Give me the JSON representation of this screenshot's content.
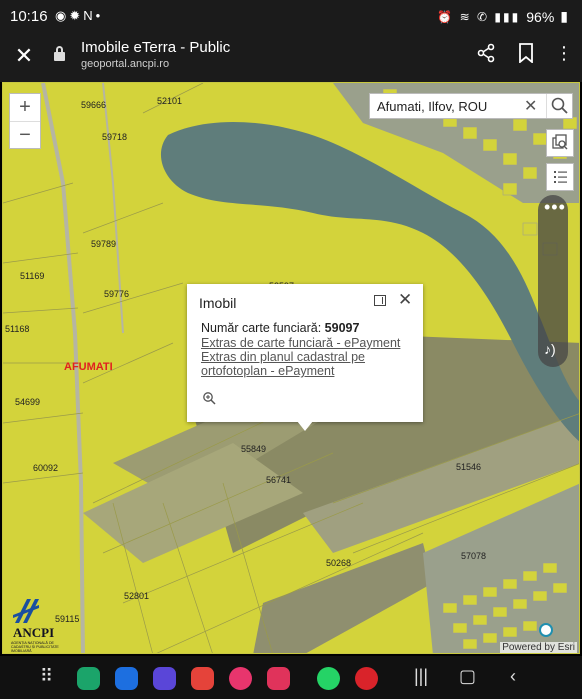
{
  "status_bar": {
    "time": "10:16",
    "left_icons": [
      "notification-icon",
      "gear-icon",
      "n-icon",
      "dot-icon"
    ],
    "battery": "96%",
    "right_icons": [
      "alarm-icon",
      "wifi-icon",
      "call-icon",
      "signal-icon",
      "battery-icon"
    ]
  },
  "browser": {
    "title": "Imobile eTerra - Public",
    "url": "geoportal.ancpi.ro",
    "close_icon": "close-icon",
    "share_icon": "share-icon",
    "bookmark_icon": "bookmark-icon",
    "menu_icon": "more-vert-icon"
  },
  "map": {
    "zoom_in": "+",
    "zoom_out": "−",
    "search": {
      "value": "Afumati, Ilfov, ROU"
    },
    "town": "AFUMATI",
    "parcels": [
      {
        "id": "p1",
        "label": "59666"
      },
      {
        "id": "p2",
        "label": "52101"
      },
      {
        "id": "p3",
        "label": "59718"
      },
      {
        "id": "p4",
        "label": "59789"
      },
      {
        "id": "p5",
        "label": "51169"
      },
      {
        "id": "p6",
        "label": "59776"
      },
      {
        "id": "p7",
        "label": "51168"
      },
      {
        "id": "p8",
        "label": "54699"
      },
      {
        "id": "p9",
        "label": "60092"
      },
      {
        "id": "p10",
        "label": "55849"
      },
      {
        "id": "p11",
        "label": "56741"
      },
      {
        "id": "p12",
        "label": "51546"
      },
      {
        "id": "p13",
        "label": "57078"
      },
      {
        "id": "p14",
        "label": "50268"
      },
      {
        "id": "p15",
        "label": "52801"
      },
      {
        "id": "p16",
        "label": "59115"
      },
      {
        "id": "p17",
        "label": "52597"
      }
    ],
    "attribution": "Powered by Esri",
    "logo_text": "ANCPI",
    "logo_subtext": "AGENȚIA NAȚIONALĂ DE CADASTRU ȘI PUBLICITATE IMOBILIARĂ",
    "colors": {
      "parcel_fill": "#d6d63a",
      "lake": "#5f7d7b",
      "road": "#b5b5a3",
      "town_label": "#e02020"
    }
  },
  "popup": {
    "title": "Imobil",
    "cf_label": "Număr carte funciară:",
    "cf_value": "59097",
    "link1": "Extras de carte funciară - ePayment",
    "link2_line1": "Extras din planul cadastral pe",
    "link2_line2": "ortofotoplan - ePayment"
  },
  "navbar": {
    "apps": [
      {
        "name": "apps-grid-icon",
        "color": ""
      },
      {
        "name": "phone-app-icon",
        "color": "#1ba46a"
      },
      {
        "name": "messages-app-icon",
        "color": "#1d6fe0"
      },
      {
        "name": "browser-app-icon",
        "color": "#5a46d8"
      },
      {
        "name": "notes-app-icon",
        "color": "#e5433a"
      },
      {
        "name": "flower-app-icon",
        "color": "#e8356d"
      },
      {
        "name": "camera-app-icon",
        "color": "#e0335b"
      },
      {
        "name": "whatsapp-app-icon",
        "color": "#25d366"
      },
      {
        "name": "red-app-icon",
        "color": "#d9232a"
      }
    ],
    "recent_icon": "recents-icon",
    "home_icon": "home-icon",
    "back_icon": "back-icon"
  }
}
